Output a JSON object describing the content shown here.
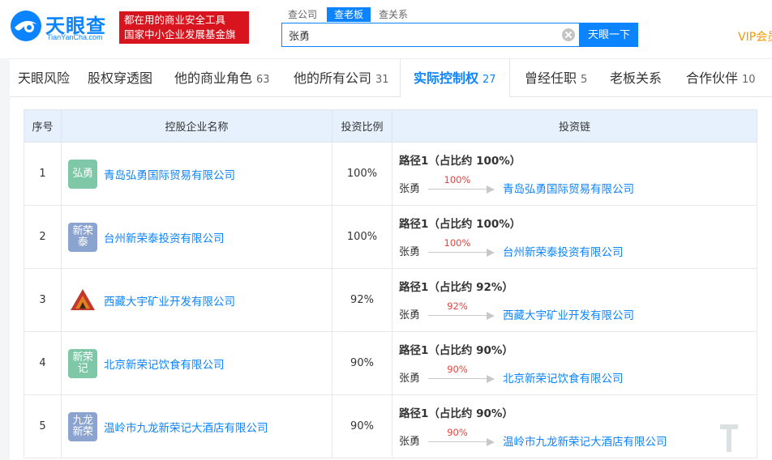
{
  "brand": {
    "name": "天眼查",
    "domain": "TianYanCha.com",
    "ad_line1": "都在用的商业安全工具",
    "ad_line2": "国家中小企业发展基金旗下"
  },
  "search": {
    "tabs": [
      {
        "label": "查公司",
        "active": false
      },
      {
        "label": "查老板",
        "active": true
      },
      {
        "label": "查关系",
        "active": false
      }
    ],
    "value": "张勇",
    "button": "天眼一下"
  },
  "vip_label": "VIP会员",
  "tabs": [
    {
      "label": "天眼风险",
      "count": ""
    },
    {
      "label": "股权穿透图",
      "count": ""
    },
    {
      "label": "他的商业角色",
      "count": "63"
    },
    {
      "label": "他的所有公司",
      "count": "31"
    },
    {
      "label": "实际控制权",
      "count": "27",
      "active": true
    },
    {
      "label": "曾经任职",
      "count": "5"
    },
    {
      "label": "老板关系",
      "count": ""
    },
    {
      "label": "合作伙伴",
      "count": "10"
    }
  ],
  "table": {
    "headers": [
      "序号",
      "控股企业名称",
      "投资比例",
      "投资链"
    ],
    "rows": [
      {
        "index": "1",
        "avatar_text": "弘勇",
        "avatar_color": "#7ec8a8",
        "company": "青岛弘勇国际贸易有限公司",
        "ratio": "100%",
        "path_title": "路径1（占比约 100%）",
        "holder": "张勇",
        "edge_pct": "100%",
        "target": "青岛弘勇国际贸易有限公司"
      },
      {
        "index": "2",
        "avatar_text": "新荣泰",
        "avatar_color": "#8ba3cf",
        "company": "台州新荣泰投资有限公司",
        "ratio": "100%",
        "path_title": "路径1（占比约 100%）",
        "holder": "张勇",
        "edge_pct": "100%",
        "target": "台州新荣泰投资有限公司"
      },
      {
        "index": "3",
        "avatar_text": "",
        "avatar_color": "logo",
        "company": "西藏大宇矿业开发有限公司",
        "ratio": "92%",
        "path_title": "路径1（占比约 92%）",
        "holder": "张勇",
        "edge_pct": "92%",
        "target": "西藏大宇矿业开发有限公司"
      },
      {
        "index": "4",
        "avatar_text": "新荣记",
        "avatar_color": "#7ec8a8",
        "company": "北京新荣记饮食有限公司",
        "ratio": "90%",
        "path_title": "路径1（占比约 90%）",
        "holder": "张勇",
        "edge_pct": "90%",
        "target": "北京新荣记饮食有限公司"
      },
      {
        "index": "5",
        "avatar_text": "九龙新荣",
        "avatar_color": "#8ba3cf",
        "company": "温岭市九龙新荣记大酒店有限公司",
        "ratio": "90%",
        "path_title": "路径1（占比约 90%）",
        "holder": "张勇",
        "edge_pct": "90%",
        "target": "温岭市九龙新荣记大酒店有限公司"
      }
    ]
  },
  "colors": {
    "accent": "#0d84ff",
    "ad_red": "#d8141e",
    "pct_red": "#e8413b",
    "vip": "#f39800"
  }
}
